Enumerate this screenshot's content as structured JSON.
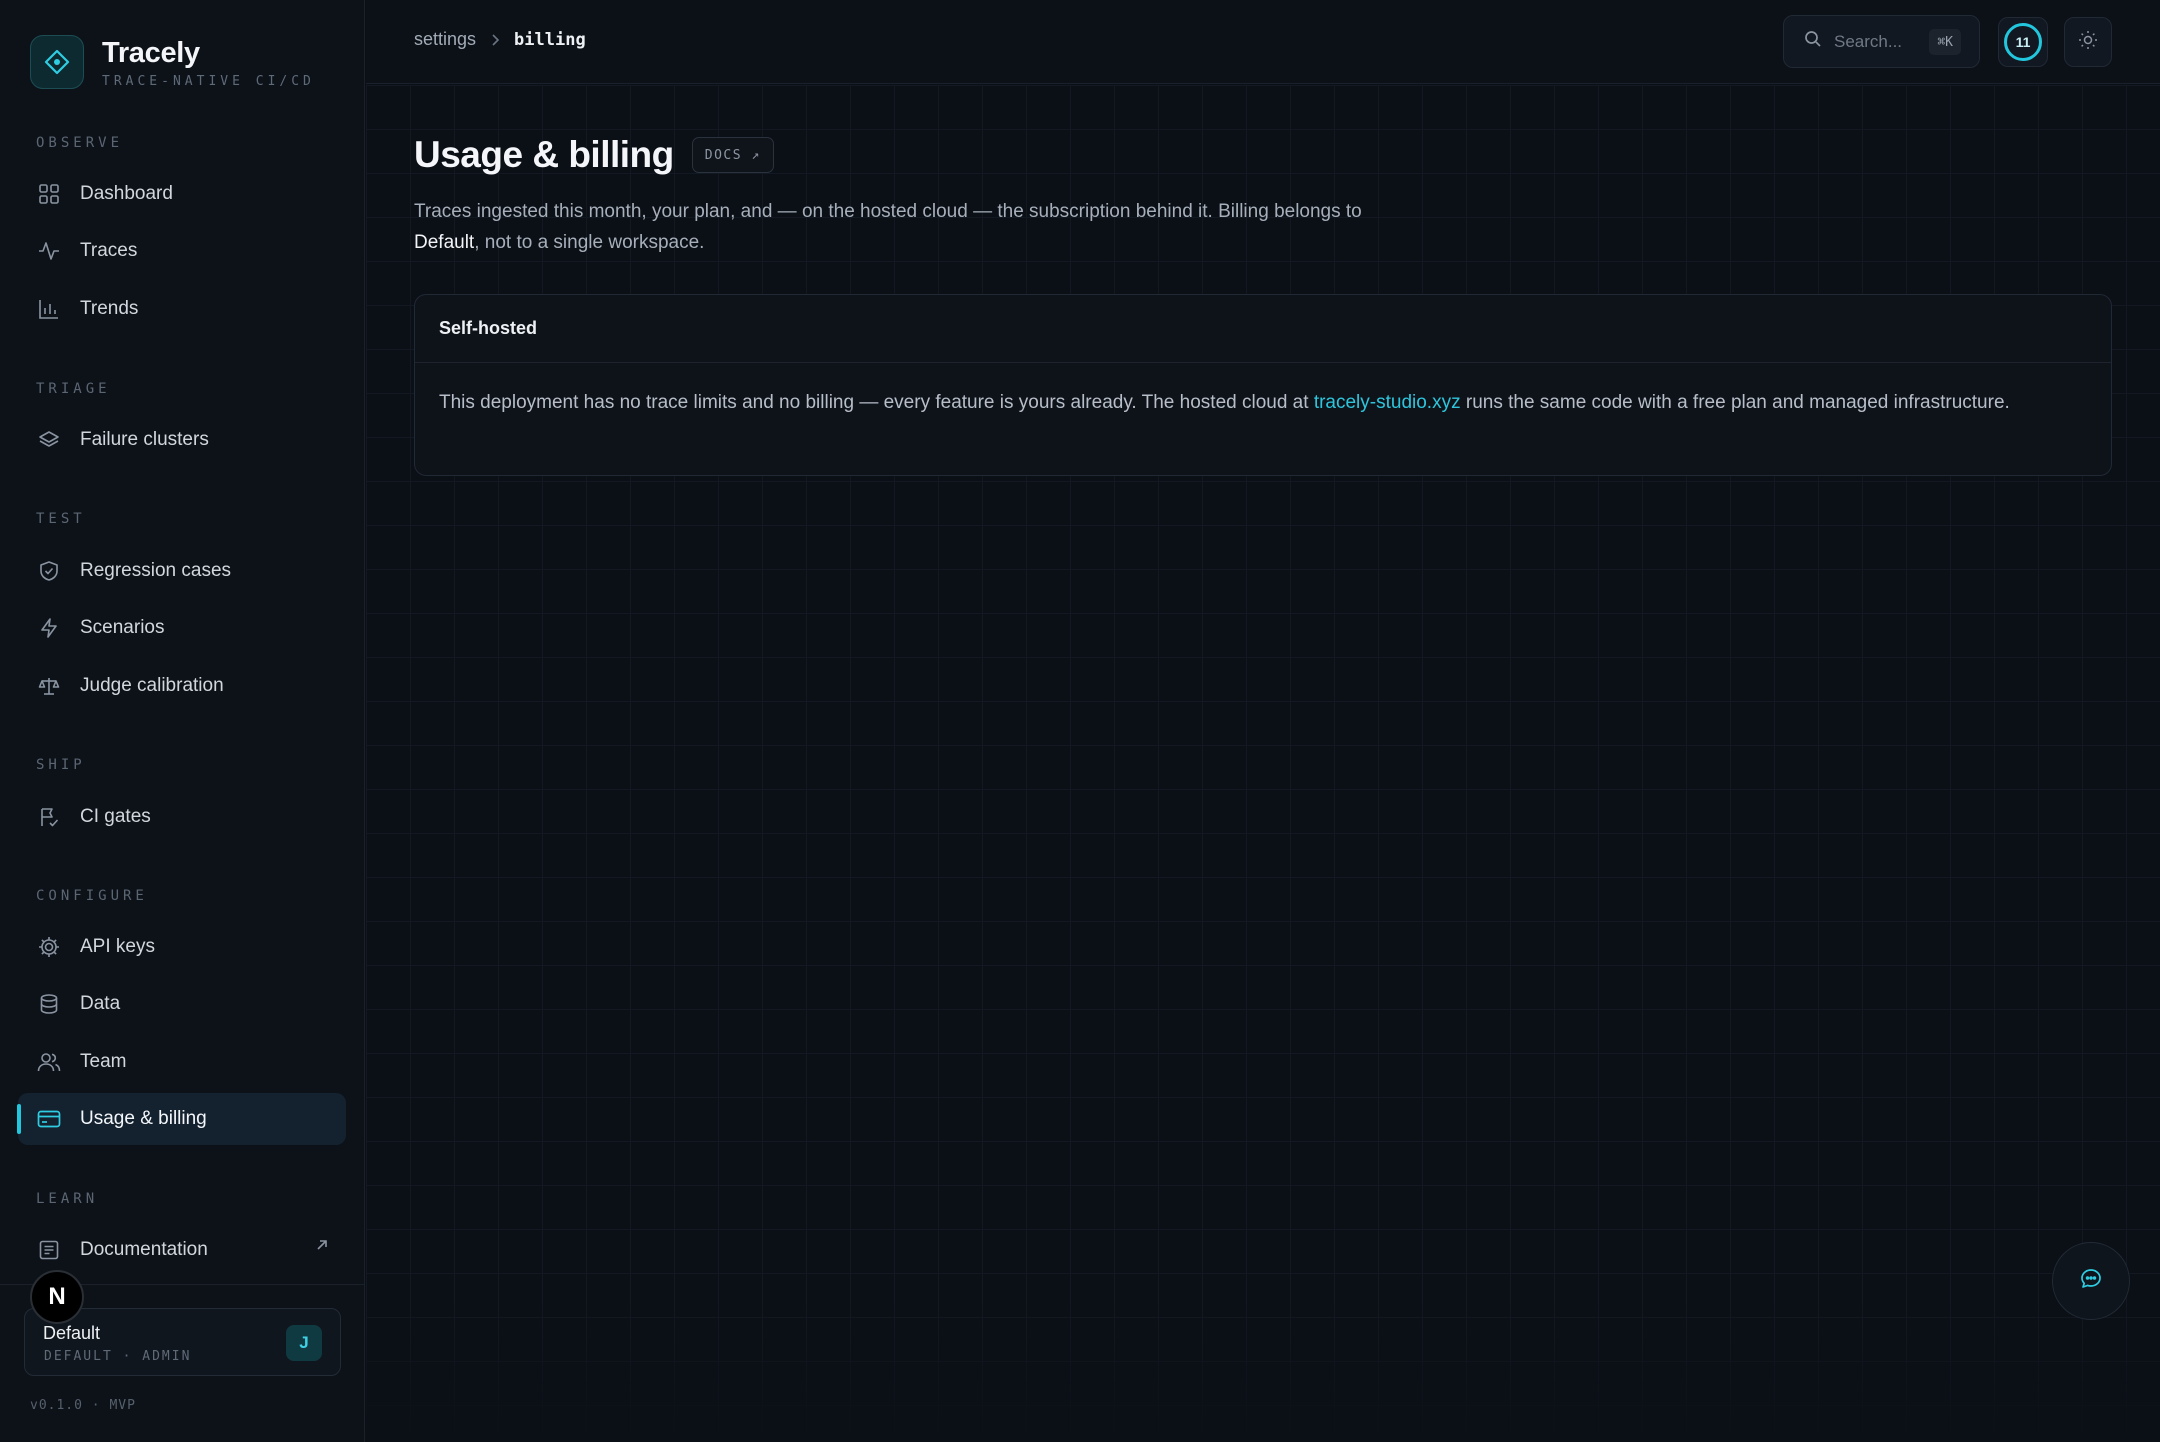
{
  "brand": {
    "name": "Tracely",
    "tagline": "TRACE-NATIVE CI/CD"
  },
  "sidebar": {
    "sections": [
      {
        "heading": "OBSERVE",
        "items": [
          {
            "label": "Dashboard",
            "icon": "grid-icon"
          },
          {
            "label": "Traces",
            "icon": "activity-icon"
          },
          {
            "label": "Trends",
            "icon": "bar-chart-icon"
          }
        ]
      },
      {
        "heading": "TRIAGE",
        "items": [
          {
            "label": "Failure clusters",
            "icon": "layers-icon"
          }
        ]
      },
      {
        "heading": "TEST",
        "items": [
          {
            "label": "Regression cases",
            "icon": "shield-icon"
          },
          {
            "label": "Scenarios",
            "icon": "bolt-icon"
          },
          {
            "label": "Judge calibration",
            "icon": "scale-icon"
          }
        ]
      },
      {
        "heading": "SHIP",
        "items": [
          {
            "label": "CI gates",
            "icon": "flag-check-icon"
          }
        ]
      },
      {
        "heading": "CONFIGURE",
        "items": [
          {
            "label": "API keys",
            "icon": "gear-icon"
          },
          {
            "label": "Data",
            "icon": "database-icon"
          },
          {
            "label": "Team",
            "icon": "users-icon"
          },
          {
            "label": "Usage & billing",
            "icon": "credit-card-icon",
            "active": true
          }
        ]
      },
      {
        "heading": "LEARN",
        "items": [
          {
            "label": "Documentation",
            "icon": "document-icon",
            "external": true
          }
        ]
      }
    ],
    "avatar_letter": "N",
    "workspace": {
      "name": "Default",
      "meta": "DEFAULT · ADMIN",
      "badge": "J"
    },
    "version": "v0.1.0 · MVP"
  },
  "topbar": {
    "breadcrumb": [
      "settings",
      "billing"
    ],
    "search_placeholder": "Search...",
    "search_shortcut": "⌘K",
    "counter": "11"
  },
  "page": {
    "title": "Usage & billing",
    "docs_chip": "DOCS ↗",
    "description_before": "Traces ingested this month, your plan, and — on the hosted cloud — the subscription behind it. Billing belongs to ",
    "description_highlight": "Default",
    "description_after": ", not to a single workspace.",
    "card": {
      "title": "Self-hosted",
      "body_before": "This deployment has no trace limits and no billing — every feature is yours already. The hosted cloud at ",
      "link": "tracely-studio.xyz",
      "body_after": " runs the same code with a free plan and managed infrastructure."
    }
  },
  "colors": {
    "accent": "#22c6dd",
    "background": "#0b0f16",
    "sidebar": "#0d1219"
  }
}
